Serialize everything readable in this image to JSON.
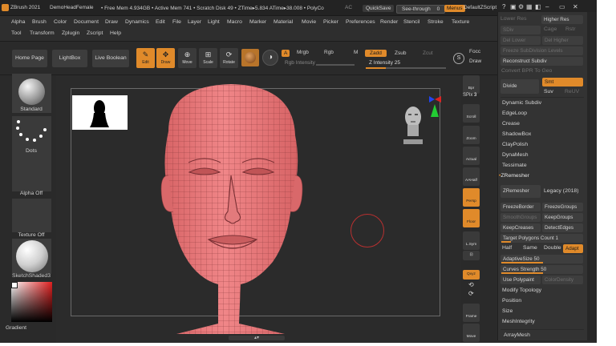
{
  "titlebar": {
    "app": "ZBrush 2021",
    "doc": "DemoHeadFemale",
    "stats": "• Free Mem 4.934GB • Active Mem 741 • Scratch Disk 49 • ZTime▸5.834 ATime▸38.008 • PolyCo",
    "extra": "AC",
    "quicksave": "QuickSave",
    "seethrough": "See-through",
    "seethrough_value": "0",
    "menus": "Menus",
    "zscript": "DefaultZScript"
  },
  "menubar": {
    "row1": [
      "Alpha",
      "Brush",
      "Color",
      "Document",
      "Draw",
      "Dynamics",
      "Edit",
      "File",
      "Layer",
      "Light",
      "Macro",
      "Marker",
      "Material",
      "Movie",
      "Picker",
      "Preferences",
      "Render",
      "Stencil",
      "Stroke",
      "Texture"
    ],
    "row2": [
      "Tool",
      "Transform",
      "Zplugin",
      "Zscript",
      "Help"
    ]
  },
  "toolbar": {
    "home": "Home Page",
    "lightbox": "LightBox",
    "liveboolean": "Live Boolean",
    "modes": [
      "Edit",
      "Draw",
      "Move",
      "Scale",
      "Rotate"
    ],
    "a": "A",
    "mrgb": "Mrgb",
    "rgb": "Rgb",
    "m": "M",
    "zadd": "Zadd",
    "zsub": "Zsub",
    "zcut": "Zcut",
    "rgb_intensity": "Rgb Intensity",
    "z_intensity": "Z Intensity 25",
    "focal": "Focc",
    "draw": "Draw"
  },
  "toolbar_values": {
    "z_intensity": 25
  },
  "leftshelf": {
    "standard": "Standard",
    "dots": "Dots",
    "alpha_off": "Alpha Off",
    "texture_off": "Texture Off",
    "material": "SketchShaded3",
    "gradient": "Gradient"
  },
  "rightshelf": {
    "spix": "SPix",
    "spix_value": "3",
    "buttons": [
      "Bpr",
      "Scroll",
      "Zoom",
      "Actual",
      "AAHalf",
      "Persp",
      "Floor",
      "L.Sym",
      "Qxyz",
      "Frame",
      "Move"
    ]
  },
  "panel": {
    "lower_res": "Lower Res",
    "higher_res": "Higher Res",
    "sdiv": "SDiv",
    "cage": "Cage",
    "rstr": "Rstr",
    "del_lower": "Del Lower",
    "del_higher": "Del Higher",
    "freeze": "Freeze SubDivision Levels",
    "reconstruct": "Reconstruct Subdiv",
    "convert_bpr": "Convert BPR To Geo",
    "divide": "Divide",
    "smt": "Smt",
    "suv": "Suv",
    "reuv": "ReUV",
    "items1": [
      "Dynamic Subdiv",
      "EdgeLoop",
      "Crease",
      "ShadowBox",
      "ClayPolish",
      "DynaMesh",
      "Tessimate"
    ],
    "zremesher_header": "ZRemesher",
    "zremesher": "ZRemesher",
    "legacy": "Legacy (2018)",
    "freezeborder": "FreezeBorder",
    "freezegroups": "FreezeGroups",
    "smoothgroups": "SmoothGroups",
    "keepgroups": "KeepGroups",
    "keepcreases": "KeepCreases",
    "detectedges": "DetectEdges",
    "target_polygons": "Target Polygons Count 1",
    "half": "Half",
    "same": "Same",
    "double": "Double",
    "adapt": "Adapt",
    "adaptivesize": "AdaptiveSize 50",
    "curves_strength": "Curves Strength 50",
    "use_polypaint": "Use Polypaint",
    "color_density": "ColorDensity",
    "items2": [
      "Modify Topology",
      "Position",
      "Size",
      "MeshIntegrity"
    ],
    "arraymesh": "ArrayMesh"
  },
  "panel_values": {
    "target_polygons": 1,
    "adaptive_size": 50,
    "curves_strength": 50
  },
  "colors": {
    "accent": "#e08a2a",
    "mesh": "#e8787a",
    "wire": "#8c3b3e",
    "bg": "#2a2a2a"
  },
  "icons": [
    "logo-icon",
    "axis-gizmo-icon",
    "head-preview-icon",
    "brush-icon",
    "edit-icon",
    "draw-icon",
    "move-icon",
    "scale-icon",
    "rotate-icon"
  ]
}
